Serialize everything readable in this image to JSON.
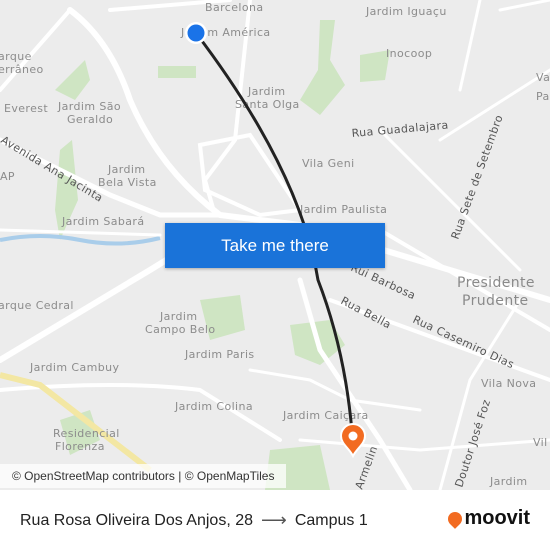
{
  "map": {
    "labels": [
      "Barcelona",
      "Jardim América",
      "Jardim Iguaçu",
      "Inocoop",
      "arque\nerrâneo",
      "Everest",
      "Jardim São",
      "Geraldo",
      "Jardim",
      "Santa Olga",
      "Va",
      "Pa",
      "Jardim",
      "Bela Vista",
      "AP",
      "Vila Geni",
      "Jardim Sabará",
      "Jardim Paulista",
      "Presidente",
      "Prudente",
      "arque Cedral",
      "Jardim",
      "Campo Belo",
      "Jardim Paris",
      "Jardim Cambuy",
      "Vila Nova",
      "Jardim Colina",
      "Jardim Caiçara",
      "Residencial",
      "Florenza",
      "Vil",
      "Jardim"
    ],
    "roads": [
      "Avenida Ana Jacinta",
      "Rua Guadalajara",
      "Rua Sete de Setembro",
      "Rui Barbosa",
      "Rua Bella",
      "Rua Casemiro Dias",
      "Armelin",
      "Doutor José Foz"
    ],
    "route_color": "#222222",
    "origin_color": "#1a73e8",
    "destination_color": "#f26b21",
    "attribution": "© OpenStreetMap contributors | © OpenMapTiles"
  },
  "cta": {
    "label": "Take me there",
    "color": "#1a73d9"
  },
  "trip": {
    "origin": "Rua Rosa Oliveira Dos Anjos, 28",
    "arrow": "⟶",
    "destination": "Campus 1"
  },
  "brand": {
    "name": "moovit",
    "color": "#f26b21"
  }
}
